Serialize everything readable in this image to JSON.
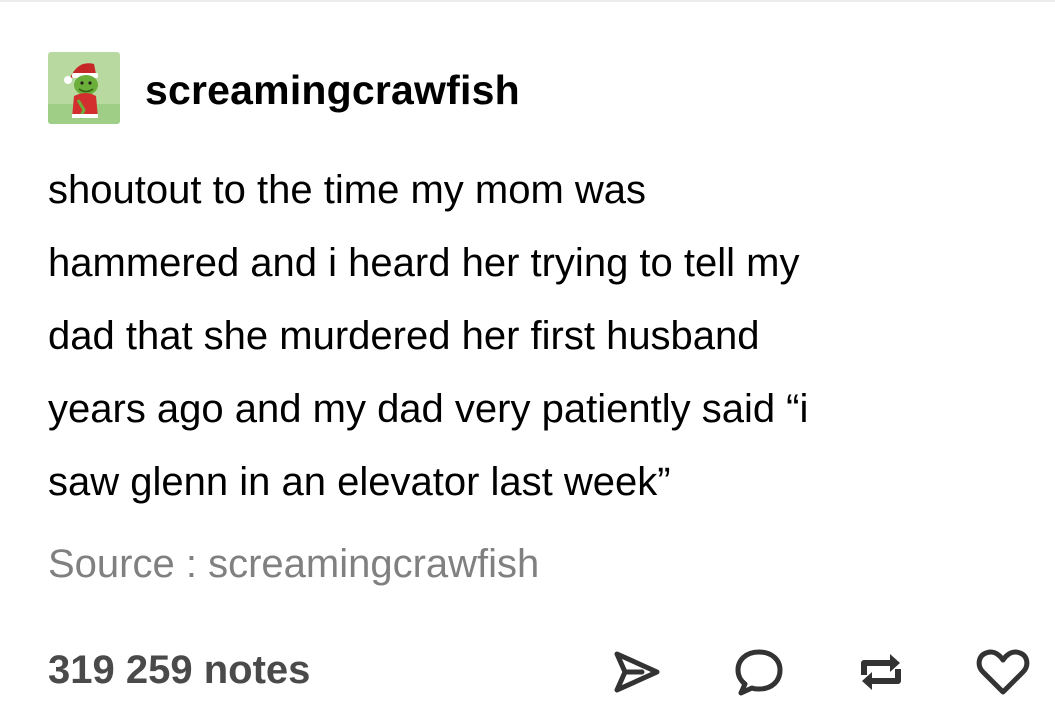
{
  "post": {
    "author": "screamingcrawfish",
    "avatar_icon": "grinch-avatar-icon",
    "body_lines": [
      "shoutout to the time my mom was",
      "hammered and i heard her trying to tell my",
      "dad that she murdered her first husband",
      "years ago and my dad very patiently said “i",
      "saw glenn in an elevator last week”"
    ],
    "source_label": "Source :",
    "source_name": "screamingcrawfish"
  },
  "footer": {
    "notes": "319 259 notes",
    "actions": [
      {
        "name": "share-icon"
      },
      {
        "name": "reply-icon"
      },
      {
        "name": "reblog-icon"
      },
      {
        "name": "like-icon"
      }
    ]
  },
  "colors": {
    "text": "#000000",
    "muted": "#808080",
    "notes": "#4a4a4a",
    "icon": "#333333",
    "avatar_bg": "#b8d9a0"
  }
}
